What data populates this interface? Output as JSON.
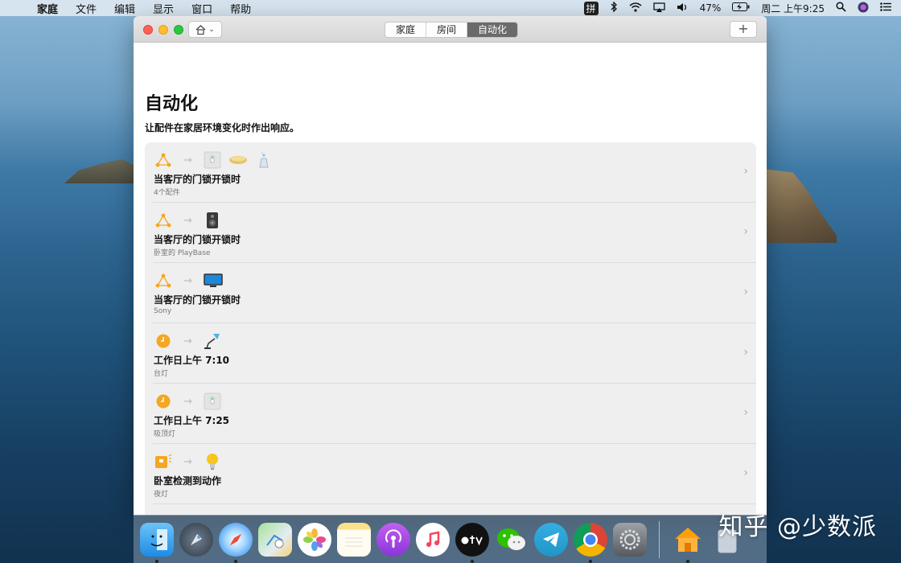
{
  "menubar": {
    "app": "家庭",
    "items": [
      "文件",
      "编辑",
      "显示",
      "窗口",
      "帮助"
    ],
    "ime": "拼",
    "battery": "47%",
    "clock": "周二 上午9:25"
  },
  "window": {
    "segments": [
      {
        "label": "家庭",
        "active": false
      },
      {
        "label": "房间",
        "active": false
      },
      {
        "label": "自动化",
        "active": true
      }
    ],
    "plus_label": "+"
  },
  "page": {
    "title": "自动化",
    "subtitle": "让配件在家居环境变化时作出响应。"
  },
  "automations": [
    {
      "trigger_icon": "people-arrive-icon",
      "accessories": [
        "light-switch-icon",
        "ceiling-light-icon",
        "diffuser-icon"
      ],
      "name": "当客厅的门锁开锁时",
      "detail": "4个配件"
    },
    {
      "trigger_icon": "people-arrive-icon",
      "accessories": [
        "speaker-icon"
      ],
      "name": "当客厅的门锁开锁时",
      "detail": "卧室的 PlayBase"
    },
    {
      "trigger_icon": "people-arrive-icon",
      "accessories": [
        "tv-icon"
      ],
      "name": "当客厅的门锁开锁时",
      "detail": "Sony"
    },
    {
      "trigger_icon": "clock-icon",
      "accessories": [
        "desk-lamp-icon"
      ],
      "name": "工作日上午 7:10",
      "detail": "台灯"
    },
    {
      "trigger_icon": "clock-icon",
      "accessories": [
        "light-switch-icon"
      ],
      "name": "工作日上午 7:25",
      "detail": "吸顶灯"
    },
    {
      "trigger_icon": "motion-sensor-icon",
      "accessories": [
        "bulb-icon"
      ],
      "name": "卧室检测到动作",
      "detail": "夜灯"
    },
    {
      "trigger_icon": "home-arrive-icon",
      "accessories": [
        "home-arrive-icon"
      ],
      "name": "",
      "detail": ""
    }
  ],
  "dock": [
    "finder",
    "launchpad",
    "safari",
    "maps",
    "photos",
    "notes",
    "podcasts",
    "music",
    "tv",
    "wechat",
    "telegram",
    "chrome",
    "system-preferences",
    "home",
    "trash"
  ],
  "watermark": "知乎 @少数派",
  "colors": {
    "accent_orange": "#f5a623",
    "active_segment": "#6a6a6a",
    "list_bg": "#efefef"
  }
}
